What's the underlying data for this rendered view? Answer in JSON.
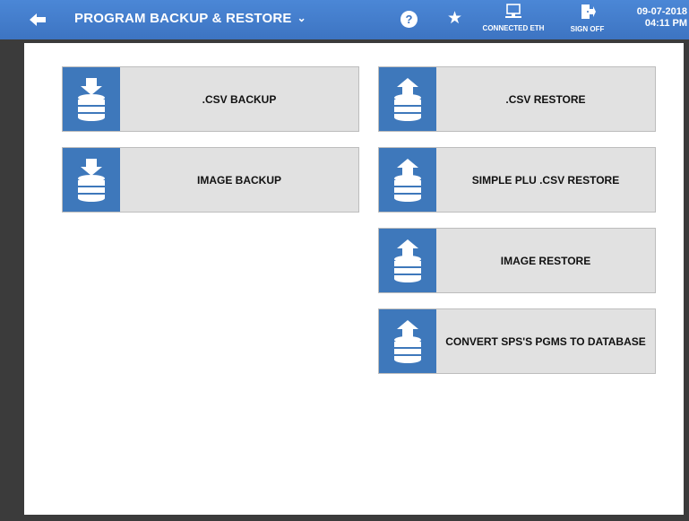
{
  "header": {
    "title": "PROGRAM BACKUP & RESTORE",
    "help_label": "?",
    "connected_label": "CONNECTED ETH",
    "signoff_label": "SIGN OFF",
    "date": "09-07-2018",
    "time": "04:11 PM"
  },
  "tiles": {
    "csv_backup": {
      "label": ".CSV BACKUP",
      "icon": "database-download-icon"
    },
    "image_backup": {
      "label": "IMAGE BACKUP",
      "icon": "database-download-icon"
    },
    "csv_restore": {
      "label": ".CSV RESTORE",
      "icon": "database-upload-icon"
    },
    "simple_plu_restore": {
      "label": "SIMPLE PLU .CSV RESTORE",
      "icon": "database-upload-icon"
    },
    "image_restore": {
      "label": "IMAGE RESTORE",
      "icon": "database-upload-icon"
    },
    "convert_sps": {
      "label": "CONVERT SPS'S PGMS TO DATABASE",
      "icon": "database-upload-icon"
    }
  },
  "colors": {
    "header_blue": "#3d74c2",
    "icon_blue": "#3e78bb",
    "tile_gray": "#e1e1e1",
    "frame_dark": "#3b3b3b"
  }
}
